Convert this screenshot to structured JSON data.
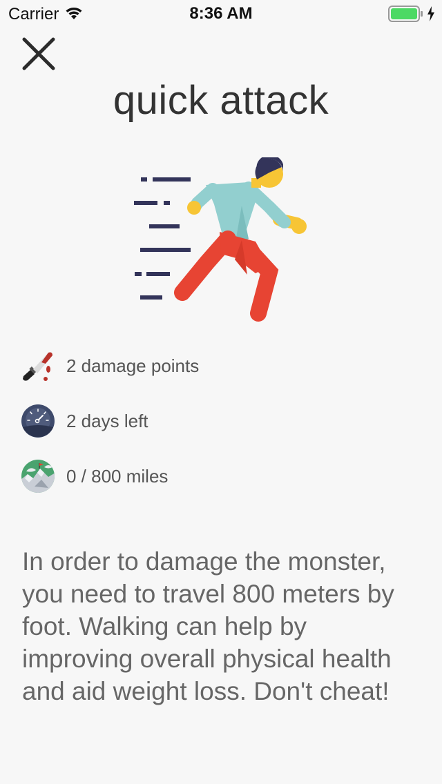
{
  "status_bar": {
    "carrier": "Carrier",
    "time": "8:36 AM"
  },
  "header": {
    "close_icon": "close-icon",
    "title": "quick attack"
  },
  "illustration": {
    "icon": "running-person-icon",
    "colors": {
      "speed_lines": "#33345a",
      "shirt": "#92cfcf",
      "pants": "#e74433",
      "skin": "#f7c535",
      "hair": "#33345a"
    }
  },
  "stats": [
    {
      "icon": "knife-icon",
      "label": "2 damage points"
    },
    {
      "icon": "timer-icon",
      "label": "2 days left"
    },
    {
      "icon": "mountain-icon",
      "label": "0 / 800 miles"
    }
  ],
  "description": "In order to damage the monster, you need to travel 800 meters by foot. Walking can help by improving overall physical health and aid weight loss. Don't cheat!"
}
